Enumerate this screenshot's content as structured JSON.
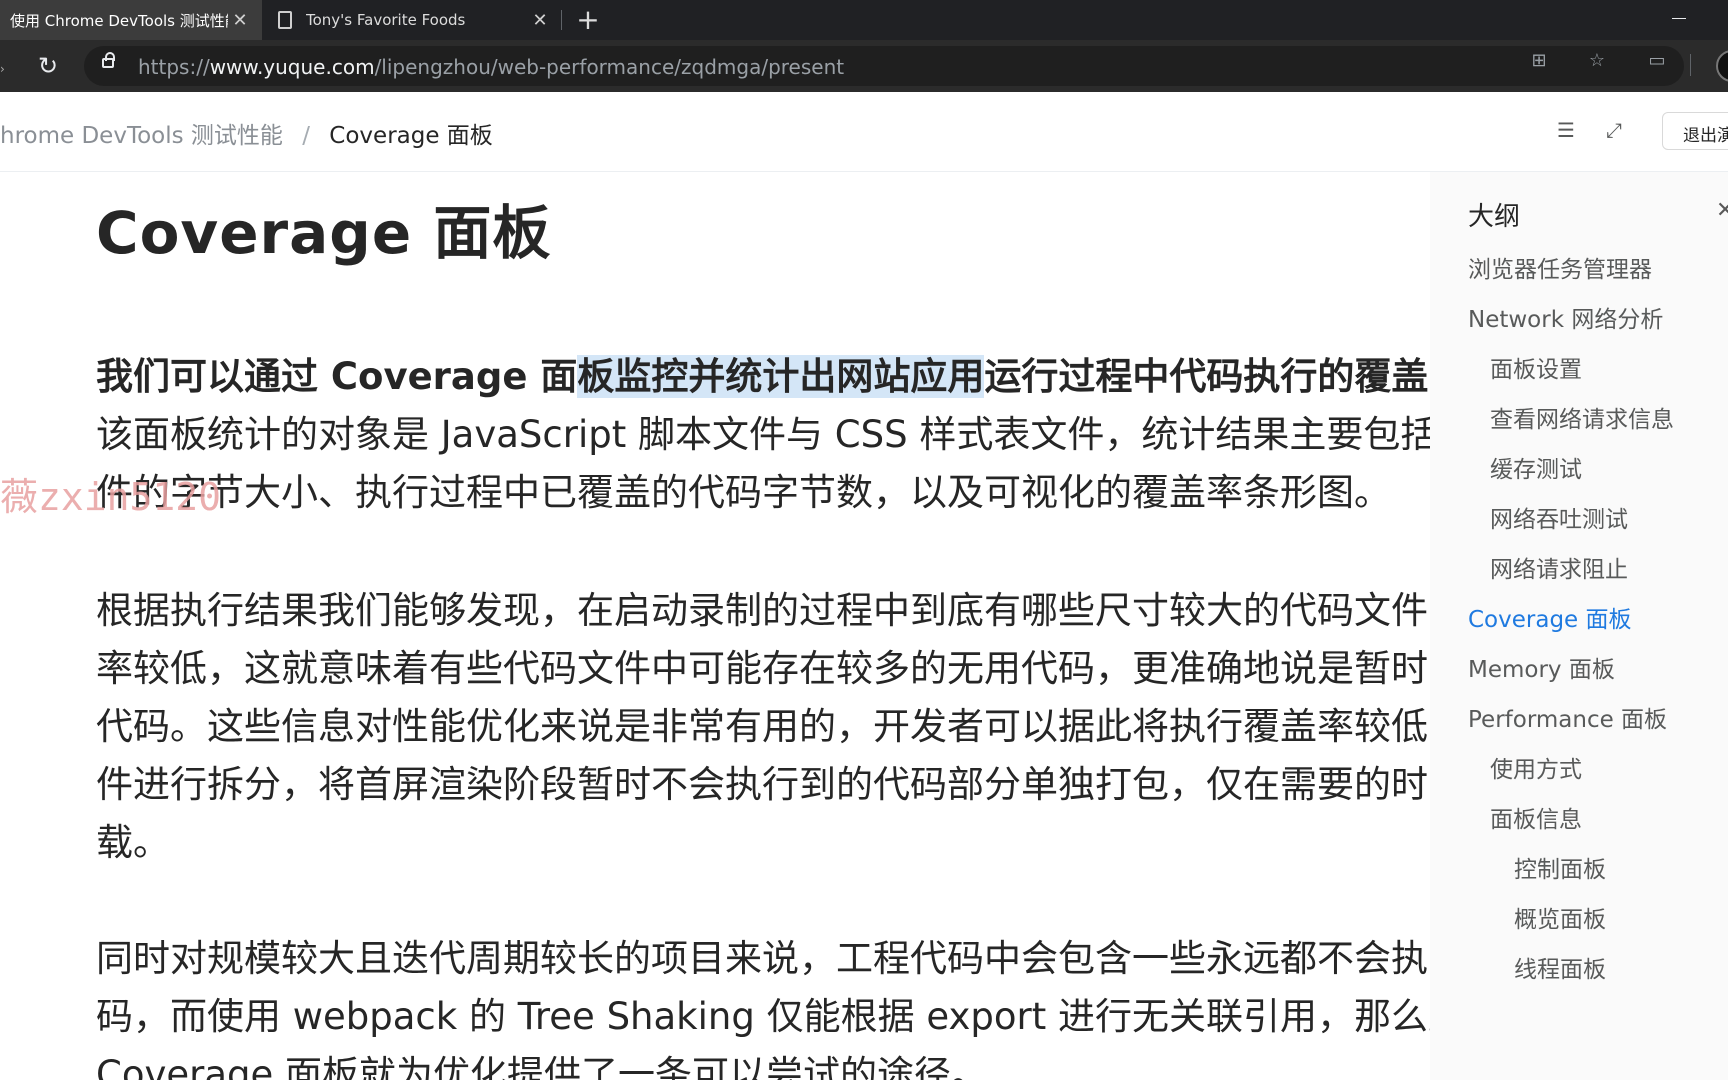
{
  "browser": {
    "tabs": [
      {
        "title": "使用 Chrome DevTools 测试性能",
        "active": true
      },
      {
        "title": "Tony's Favorite Foods",
        "active": false
      }
    ],
    "new_tab_symbol": "+",
    "close_symbol": "✕",
    "url_scheme": "https://",
    "url_host": "www.yuque.com",
    "url_path": "/lipengzhou/web-performance/zqdmga/present"
  },
  "header": {
    "breadcrumb_parent": "hrome DevTools 测试性能",
    "breadcrumb_sep": "/",
    "breadcrumb_current": "Coverage 面板",
    "exit_label": "退出演示"
  },
  "article": {
    "title": "Coverage 面板",
    "p1": {
      "line1_a": "我们可以通过 Coverage 面",
      "line1_hl": "板监控并统计出网站应用",
      "line1_b": "运行过程中代码执行的覆盖",
      "line2": "该面板统计的对象是 JavaScript 脚本文件与 CSS 样式表文件，统计结果主要包括",
      "line3": "件的字节大小、执行过程中已覆盖的代码字节数，以及可视化的覆盖率条形图。"
    },
    "p2": [
      "根据执行结果我们能够发现，在启动录制的过程中到底有哪些尺寸较大的代码文件",
      "率较低，这就意味着有些代码文件中可能存在较多的无用代码，更准确地说是暂时",
      "代码。这些信息对性能优化来说是非常有用的，开发者可以据此将执行覆盖率较低",
      "件进行拆分，将首屏渲染阶段暂时不会执行到的代码部分单独打包，仅在需要的时",
      "载。"
    ],
    "p3": [
      "同时对规模较大且迭代周期较长的项目来说，工程代码中会包含一些永远都不会执",
      "码，而使用 webpack 的 Tree Shaking 仅能根据 export 进行无关联引用，那么此",
      "Coverage 面板就为优化提供了一条可以尝试的途径。"
    ],
    "watermark": "薇zxin5120"
  },
  "outline": {
    "title": "大纲",
    "items": [
      {
        "label": "浏览器任务管理器",
        "level": 1,
        "active": false
      },
      {
        "label": "Network 网络分析",
        "level": 1,
        "active": false
      },
      {
        "label": "面板设置",
        "level": 2,
        "active": false
      },
      {
        "label": "查看网络请求信息",
        "level": 2,
        "active": false
      },
      {
        "label": "缓存测试",
        "level": 2,
        "active": false
      },
      {
        "label": "网络吞吐测试",
        "level": 2,
        "active": false
      },
      {
        "label": "网络请求阻止",
        "level": 2,
        "active": false
      },
      {
        "label": "Coverage 面板",
        "level": 1,
        "active": true
      },
      {
        "label": "Memory 面板",
        "level": 1,
        "active": false
      },
      {
        "label": "Performance 面板",
        "level": 1,
        "active": false
      },
      {
        "label": "使用方式",
        "level": 2,
        "active": false
      },
      {
        "label": "面板信息",
        "level": 2,
        "active": false
      },
      {
        "label": "控制面板",
        "level": 3,
        "active": false
      },
      {
        "label": "概览面板",
        "level": 3,
        "active": false
      },
      {
        "label": "线程面板",
        "level": 3,
        "active": false
      }
    ]
  },
  "colors": {
    "accent": "#1f7ae0",
    "highlight": "#d4e6f7",
    "tabstrip": "#202124",
    "toolbar": "#2b2b2b"
  }
}
